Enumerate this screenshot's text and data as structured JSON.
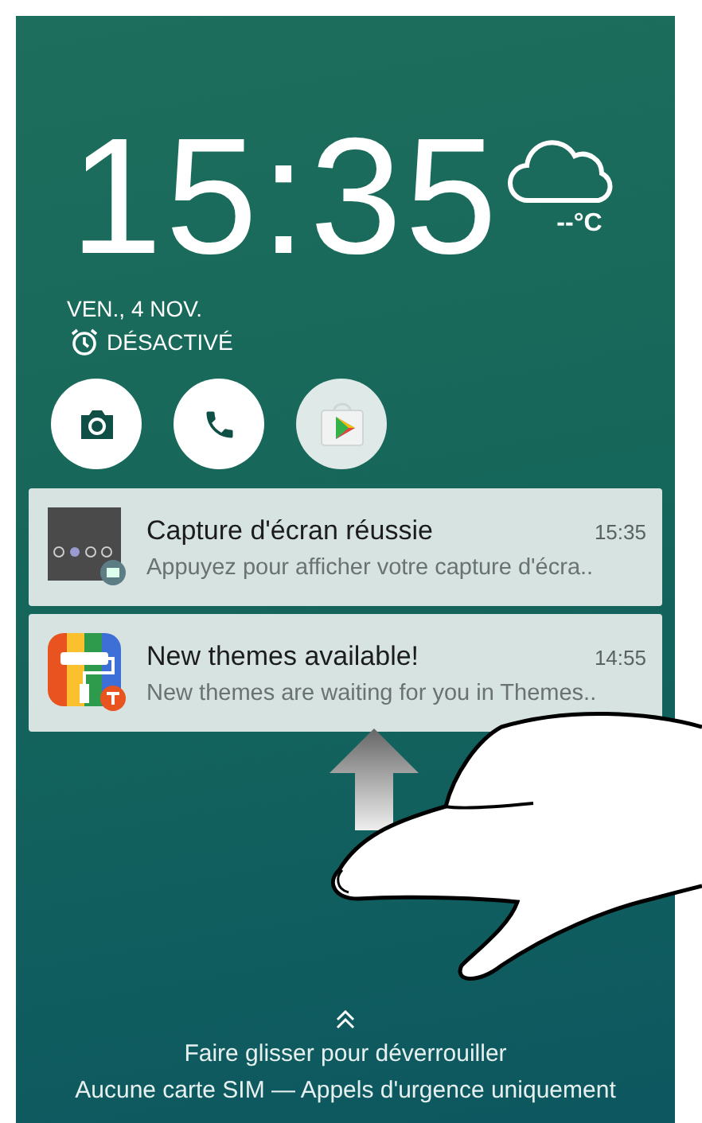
{
  "clock": {
    "time": "15:35",
    "temperature": "--°C",
    "date": "VEN., 4 NOV.",
    "alarm": "DÉSACTIVÉ"
  },
  "shortcuts": [
    {
      "kind": "camera"
    },
    {
      "kind": "phone"
    },
    {
      "kind": "store"
    }
  ],
  "notifications": [
    {
      "kind": "screenshot",
      "title": "Capture d'écran réussie",
      "time": "15:35",
      "text": "Appuyez pour afficher votre capture d'écra.."
    },
    {
      "kind": "themes",
      "title": "New themes available!",
      "time": "14:55",
      "text": "New themes are waiting for you in Themes.."
    }
  ],
  "unlock_hint": "Faire glisser pour déverrouiller",
  "status": "Aucune carte SIM — Appels d'urgence uniquement"
}
